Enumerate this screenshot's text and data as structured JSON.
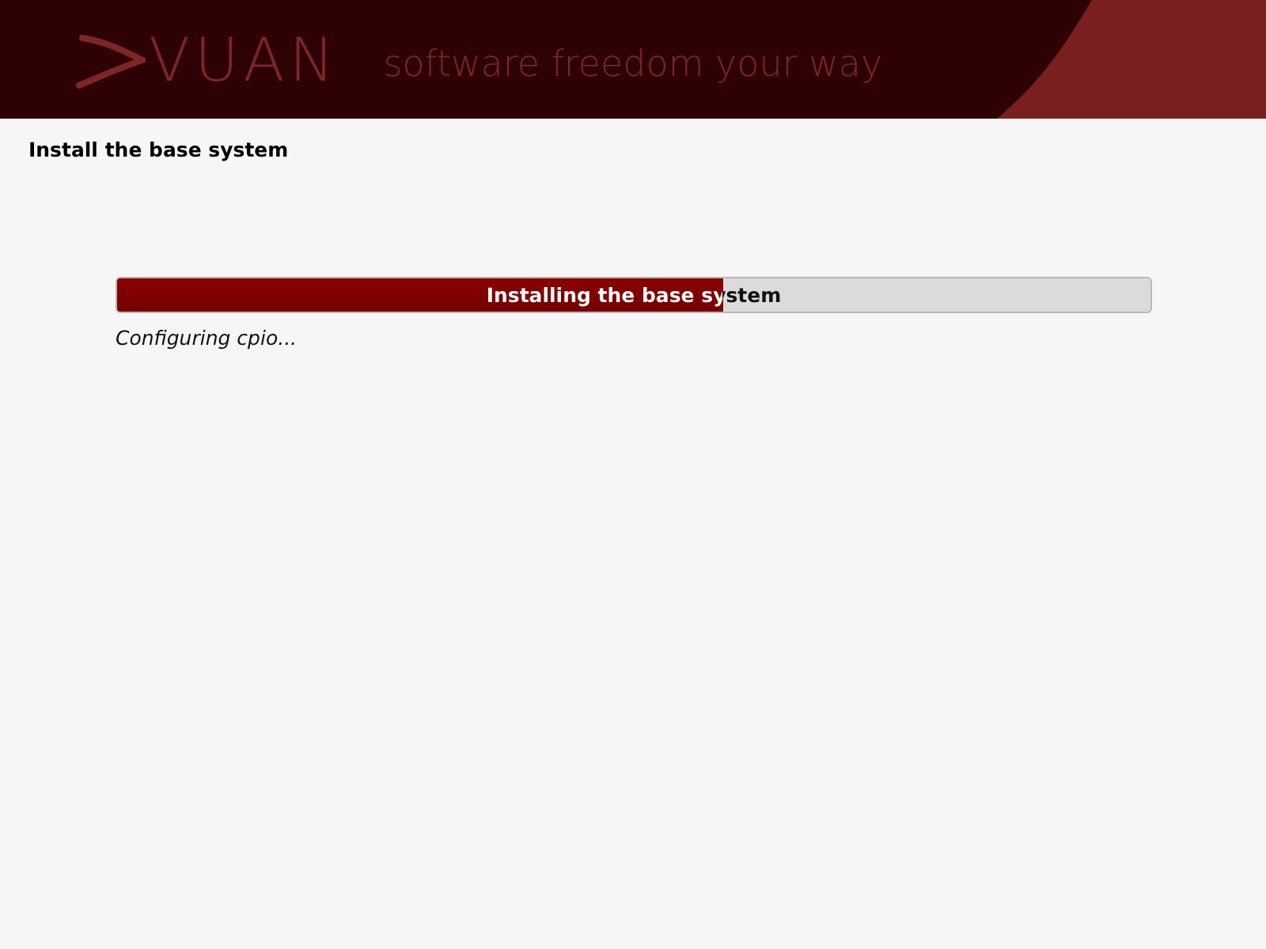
{
  "header": {
    "logo": "VUAN",
    "tagline": "software freedom your way"
  },
  "title": "Install the base system",
  "progress": {
    "label": "Installing the base system",
    "level": 0.586
  },
  "status": "Configuring cpio..."
}
